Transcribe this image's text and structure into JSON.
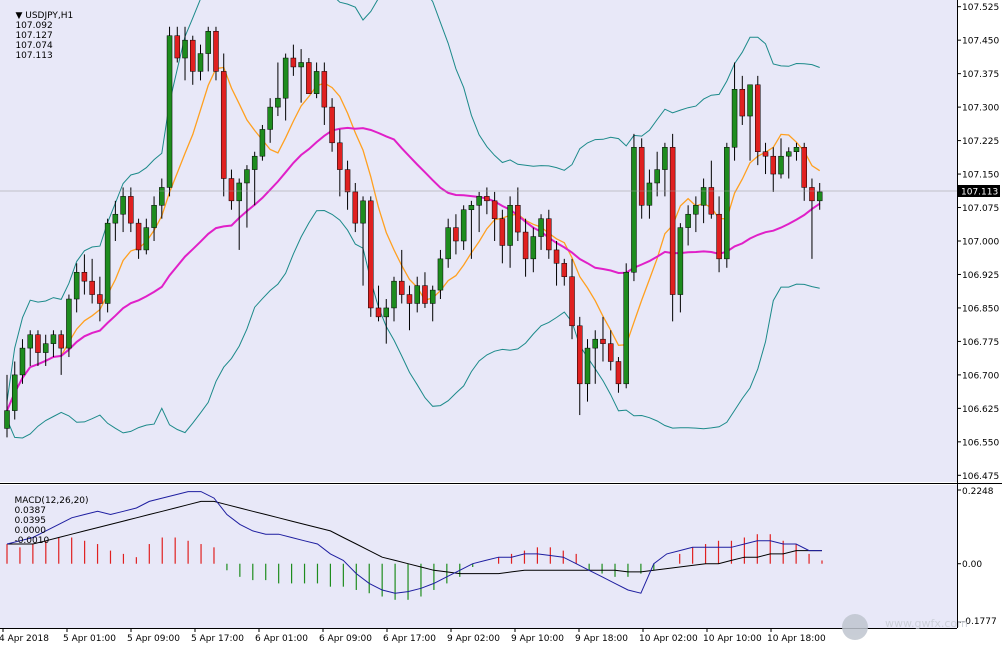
{
  "symbol": "USDJPY,H1",
  "quote": {
    "open": "107.092",
    "high": "107.127",
    "low": "107.074",
    "close": "107.113"
  },
  "current_price_tag": "107.113",
  "price_axis_ticks": [
    "107.525",
    "107.450",
    "107.375",
    "107.300",
    "107.225",
    "107.150",
    "107.075",
    "107.000",
    "106.925",
    "106.850",
    "106.775",
    "106.700",
    "106.625",
    "106.550",
    "106.475"
  ],
  "macd": {
    "label": "MACD(12,26,20)",
    "values": [
      "0.0387",
      "0.0395",
      "0.0000",
      "-0.0010"
    ],
    "axis_ticks": [
      "0.2248",
      "0.00",
      "-0.1777"
    ]
  },
  "time_labels": [
    "4 Apr 2018",
    "5 Apr 01:00",
    "5 Apr 09:00",
    "5 Apr 17:00",
    "6 Apr 01:00",
    "6 Apr 09:00",
    "6 Apr 17:00",
    "9 Apr 02:00",
    "9 Apr 10:00",
    "9 Apr 18:00",
    "10 Apr 02:00",
    "10 Apr 10:00",
    "10 Apr 18:00"
  ],
  "watermark": "www.gwfx.com",
  "colors": {
    "background": "#e8e8f8",
    "bull": "#1e8c1e",
    "bear": "#e02020",
    "bollinger": "#1c8a8a",
    "ma_fast": "#ffa020",
    "ma_slow": "#e020c8",
    "macd_line": "#1e1ea0",
    "signal_line": "#000000",
    "hist_pos": "#e02020",
    "hist_neg": "#1e8c1e"
  },
  "chart_data": [
    {
      "type": "candlestick",
      "title": "USDJPY,H1",
      "ylim": [
        106.46,
        107.54
      ],
      "grid": false,
      "candles": [
        [
          106.58,
          106.7,
          106.56,
          106.62
        ],
        [
          106.62,
          106.73,
          106.6,
          106.7
        ],
        [
          106.7,
          106.78,
          106.68,
          106.76
        ],
        [
          106.76,
          106.8,
          106.72,
          106.79
        ],
        [
          106.79,
          106.8,
          106.72,
          106.75
        ],
        [
          106.75,
          106.79,
          106.72,
          106.77
        ],
        [
          106.77,
          106.8,
          106.74,
          106.79
        ],
        [
          106.79,
          106.8,
          106.7,
          106.76
        ],
        [
          106.76,
          106.88,
          106.74,
          106.87
        ],
        [
          106.87,
          106.95,
          106.84,
          106.93
        ],
        [
          106.93,
          106.97,
          106.88,
          106.91
        ],
        [
          106.91,
          106.96,
          106.86,
          106.88
        ],
        [
          106.88,
          106.92,
          106.82,
          106.86
        ],
        [
          106.86,
          107.05,
          106.84,
          107.04
        ],
        [
          107.04,
          107.09,
          107.0,
          107.06
        ],
        [
          107.06,
          107.12,
          107.02,
          107.1
        ],
        [
          107.1,
          107.12,
          107.02,
          107.04
        ],
        [
          107.04,
          107.05,
          106.96,
          106.98
        ],
        [
          106.98,
          107.05,
          106.97,
          107.03
        ],
        [
          107.03,
          107.1,
          107.0,
          107.08
        ],
        [
          107.08,
          107.14,
          107.05,
          107.12
        ],
        [
          107.12,
          107.48,
          107.1,
          107.46
        ],
        [
          107.46,
          107.48,
          107.4,
          107.41
        ],
        [
          107.41,
          107.48,
          107.36,
          107.45
        ],
        [
          107.45,
          107.46,
          107.35,
          107.38
        ],
        [
          107.38,
          107.44,
          107.36,
          107.42
        ],
        [
          107.42,
          107.48,
          107.38,
          107.47
        ],
        [
          107.47,
          107.48,
          107.36,
          107.38
        ],
        [
          107.38,
          107.42,
          107.1,
          107.14
        ],
        [
          107.14,
          107.16,
          107.07,
          107.09
        ],
        [
          107.09,
          107.14,
          106.98,
          107.13
        ],
        [
          107.13,
          107.17,
          107.03,
          107.16
        ],
        [
          107.16,
          107.2,
          107.08,
          107.19
        ],
        [
          107.19,
          107.26,
          107.18,
          107.25
        ],
        [
          107.25,
          107.32,
          107.22,
          107.3
        ],
        [
          107.3,
          107.4,
          107.28,
          107.32
        ],
        [
          107.32,
          107.42,
          107.27,
          107.41
        ],
        [
          107.41,
          107.44,
          107.37,
          107.39
        ],
        [
          107.39,
          107.43,
          107.31,
          107.4
        ],
        [
          107.4,
          107.41,
          107.33,
          107.33
        ],
        [
          107.33,
          107.4,
          107.32,
          107.38
        ],
        [
          107.38,
          107.4,
          107.26,
          107.3
        ],
        [
          107.3,
          107.32,
          107.2,
          107.22
        ],
        [
          107.22,
          107.25,
          107.1,
          107.16
        ],
        [
          107.16,
          107.18,
          107.07,
          107.11
        ],
        [
          107.11,
          107.13,
          107.02,
          107.04
        ],
        [
          107.04,
          107.1,
          106.9,
          107.09
        ],
        [
          107.09,
          107.1,
          106.83,
          106.85
        ],
        [
          106.85,
          106.9,
          106.82,
          106.83
        ],
        [
          106.83,
          106.87,
          106.77,
          106.85
        ],
        [
          106.85,
          106.92,
          106.82,
          106.91
        ],
        [
          106.91,
          106.98,
          106.86,
          106.88
        ],
        [
          106.88,
          106.9,
          106.8,
          106.86
        ],
        [
          106.86,
          106.92,
          106.84,
          106.9
        ],
        [
          106.9,
          106.93,
          106.85,
          106.86
        ],
        [
          106.86,
          106.9,
          106.82,
          106.89
        ],
        [
          106.89,
          106.98,
          106.87,
          106.96
        ],
        [
          106.96,
          107.05,
          106.94,
          107.03
        ],
        [
          107.03,
          107.06,
          106.97,
          107.0
        ],
        [
          107.0,
          107.08,
          106.98,
          107.07
        ],
        [
          107.07,
          107.09,
          106.96,
          107.08
        ],
        [
          107.08,
          107.11,
          107.02,
          107.1
        ],
        [
          107.1,
          107.12,
          107.06,
          107.09
        ],
        [
          107.09,
          107.11,
          107.0,
          107.05
        ],
        [
          107.05,
          107.07,
          106.95,
          106.99
        ],
        [
          106.99,
          107.1,
          106.94,
          107.08
        ],
        [
          107.08,
          107.12,
          107.0,
          107.02
        ],
        [
          107.02,
          107.05,
          106.92,
          106.96
        ],
        [
          106.96,
          107.03,
          106.93,
          107.01
        ],
        [
          107.01,
          107.06,
          106.98,
          107.05
        ],
        [
          107.05,
          107.07,
          106.96,
          106.98
        ],
        [
          106.98,
          107.0,
          106.9,
          106.95
        ],
        [
          106.95,
          106.96,
          106.9,
          106.92
        ],
        [
          106.92,
          106.96,
          106.78,
          106.81
        ],
        [
          106.81,
          106.83,
          106.61,
          106.68
        ],
        [
          106.68,
          106.78,
          106.64,
          106.76
        ],
        [
          106.76,
          106.8,
          106.68,
          106.78
        ],
        [
          106.78,
          106.83,
          106.73,
          106.77
        ],
        [
          106.77,
          106.8,
          106.71,
          106.73
        ],
        [
          106.73,
          106.74,
          106.66,
          106.68
        ],
        [
          106.68,
          106.95,
          106.67,
          106.93
        ],
        [
          106.93,
          107.24,
          106.91,
          107.21
        ],
        [
          107.21,
          107.23,
          107.05,
          107.08
        ],
        [
          107.08,
          107.16,
          107.05,
          107.13
        ],
        [
          107.13,
          107.2,
          107.1,
          107.16
        ],
        [
          107.16,
          107.22,
          107.1,
          107.21
        ],
        [
          107.21,
          107.24,
          106.82,
          106.88
        ],
        [
          106.88,
          107.04,
          106.84,
          107.03
        ],
        [
          107.03,
          107.08,
          106.99,
          107.06
        ],
        [
          107.06,
          107.1,
          107.02,
          107.08
        ],
        [
          107.08,
          107.14,
          107.04,
          107.12
        ],
        [
          107.12,
          107.18,
          107.05,
          107.06
        ],
        [
          107.06,
          107.1,
          106.93,
          106.96
        ],
        [
          106.96,
          107.22,
          106.94,
          107.21
        ],
        [
          107.21,
          107.4,
          107.18,
          107.34
        ],
        [
          107.34,
          107.37,
          107.26,
          107.28
        ],
        [
          107.28,
          107.35,
          107.18,
          107.35
        ],
        [
          107.35,
          107.37,
          107.17,
          107.2
        ],
        [
          107.2,
          107.22,
          107.15,
          107.19
        ],
        [
          107.19,
          107.21,
          107.11,
          107.15
        ],
        [
          107.15,
          107.23,
          107.14,
          107.19
        ],
        [
          107.19,
          107.21,
          107.14,
          107.2
        ],
        [
          107.2,
          107.22,
          107.18,
          107.21
        ],
        [
          107.21,
          107.22,
          107.09,
          107.12
        ],
        [
          107.12,
          107.14,
          106.96,
          107.09
        ],
        [
          107.09,
          107.13,
          107.07,
          107.11
        ]
      ]
    },
    {
      "type": "macd",
      "title": "MACD(12,26,20)",
      "ylim": [
        -0.1777,
        0.2248
      ],
      "macd_line": [
        0.06,
        0.07,
        0.08,
        0.1,
        0.12,
        0.14,
        0.15,
        0.16,
        0.15,
        0.16,
        0.17,
        0.19,
        0.2,
        0.21,
        0.22,
        0.22,
        0.2,
        0.15,
        0.12,
        0.1,
        0.09,
        0.09,
        0.08,
        0.07,
        0.06,
        0.03,
        0.01,
        -0.03,
        -0.06,
        -0.08,
        -0.09,
        -0.085,
        -0.075,
        -0.06,
        -0.04,
        -0.02,
        0.0,
        0.01,
        0.02,
        0.02,
        0.03,
        0.03,
        0.025,
        0.02,
        0.0,
        -0.02,
        -0.04,
        -0.06,
        -0.08,
        -0.09,
        0.0,
        0.03,
        0.04,
        0.05,
        0.05,
        0.05,
        0.05,
        0.06,
        0.07,
        0.07,
        0.06,
        0.06,
        0.04,
        0.04
      ],
      "signal_line": [
        0.06,
        0.06,
        0.06,
        0.07,
        0.08,
        0.09,
        0.1,
        0.11,
        0.12,
        0.13,
        0.14,
        0.15,
        0.16,
        0.17,
        0.18,
        0.19,
        0.19,
        0.18,
        0.17,
        0.16,
        0.15,
        0.14,
        0.13,
        0.12,
        0.11,
        0.1,
        0.08,
        0.06,
        0.04,
        0.02,
        0.01,
        0.0,
        -0.01,
        -0.02,
        -0.025,
        -0.03,
        -0.03,
        -0.03,
        -0.03,
        -0.025,
        -0.02,
        -0.02,
        -0.02,
        -0.02,
        -0.02,
        -0.02,
        -0.02,
        -0.02,
        -0.025,
        -0.025,
        -0.02,
        -0.015,
        -0.01,
        -0.005,
        0.0,
        0.0,
        0.01,
        0.02,
        0.02,
        0.03,
        0.03,
        0.04,
        0.04,
        0.04
      ],
      "histogram": [
        0.06,
        0.05,
        0.06,
        0.07,
        0.08,
        0.08,
        0.07,
        0.06,
        0.04,
        0.03,
        0.02,
        0.06,
        0.08,
        0.08,
        0.07,
        0.06,
        0.05,
        -0.02,
        -0.04,
        -0.05,
        -0.05,
        -0.06,
        -0.06,
        -0.06,
        -0.06,
        -0.07,
        -0.07,
        -0.08,
        -0.09,
        -0.1,
        -0.11,
        -0.11,
        -0.1,
        -0.08,
        -0.06,
        -0.04,
        -0.01,
        0.0,
        0.02,
        0.03,
        0.04,
        0.05,
        0.05,
        0.04,
        0.03,
        -0.02,
        -0.03,
        -0.04,
        -0.04,
        -0.03,
        -0.02,
        0.0,
        0.03,
        0.05,
        0.06,
        0.07,
        0.07,
        0.08,
        0.09,
        0.09,
        0.07,
        0.06,
        0.03,
        0.01
      ]
    }
  ]
}
